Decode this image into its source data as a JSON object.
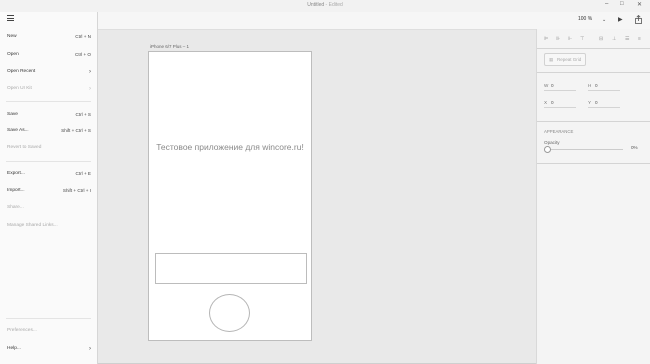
{
  "window": {
    "title": "Untitled",
    "subtitle": "Edited"
  },
  "toolbar": {
    "zoom": "100 %"
  },
  "menu": {
    "items": [
      {
        "label": "New",
        "shortcut": "Ctrl + N"
      },
      {
        "label": "Open",
        "shortcut": "Ctrl + O"
      },
      {
        "label": "Open Recent",
        "shortcut": "›"
      },
      {
        "label": "Open UI Kit",
        "shortcut": "›"
      },
      {
        "label": "Save",
        "shortcut": "Ctrl + S"
      },
      {
        "label": "Save As...",
        "shortcut": "Shift + Ctrl + S"
      },
      {
        "label": "Revert to Saved",
        "shortcut": ""
      },
      {
        "label": "Export...",
        "shortcut": "Ctrl + E"
      },
      {
        "label": "Import...",
        "shortcut": "Shift + Ctrl + I"
      },
      {
        "label": "Share...",
        "shortcut": ""
      },
      {
        "label": "Manage Shared Links...",
        "shortcut": ""
      },
      {
        "label": "Preferences...",
        "shortcut": ""
      },
      {
        "label": "Help...",
        "shortcut": "›"
      }
    ]
  },
  "canvas": {
    "artboard_label": "iPhone 6/7 Plus – 1",
    "text": "Тестовое приложение для wincore.ru!"
  },
  "panel": {
    "repeat_grid": "Repeat Grid",
    "w_label": "W",
    "w_value": "0",
    "h_label": "H",
    "h_value": "0",
    "x_label": "X",
    "x_value": "0",
    "y_label": "Y",
    "y_value": "0",
    "appearance": "APPEARANCE",
    "opacity_label": "Opacity",
    "opacity_value": "0%"
  }
}
